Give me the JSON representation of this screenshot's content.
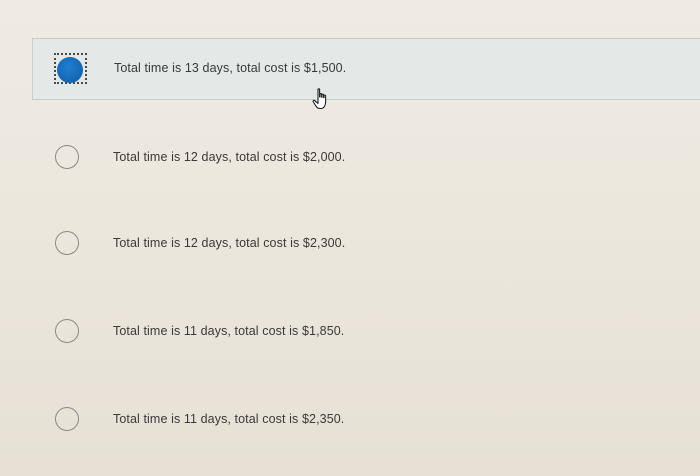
{
  "question": {
    "options": [
      {
        "label": "Total time is 13 days, total cost is $1,500.",
        "selected": true
      },
      {
        "label": "Total time is 12 days, total cost is $2,000.",
        "selected": false
      },
      {
        "label": "Total time is 12 days, total cost is $2,300.",
        "selected": false
      },
      {
        "label": "Total time is 11 days, total cost is $1,850.",
        "selected": false
      },
      {
        "label": "Total time is 11 days, total cost is $2,350.",
        "selected": false
      }
    ],
    "accent_color": "#1466b3"
  },
  "pointer": {
    "icon": "hand-pointer-icon"
  }
}
